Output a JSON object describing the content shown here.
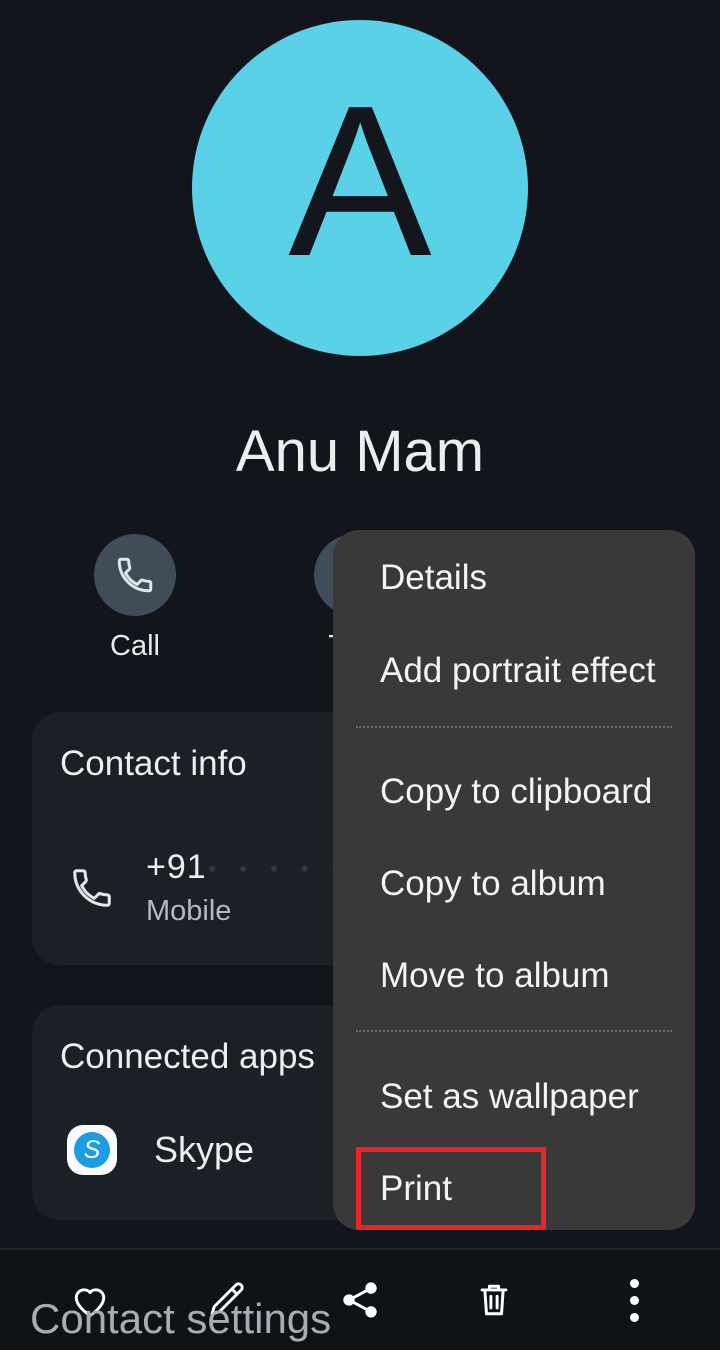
{
  "contact": {
    "avatar_letter": "A",
    "avatar_color": "#5bd1e8",
    "name": "Anu Mam"
  },
  "quick_actions": [
    {
      "id": "call",
      "label": "Call",
      "icon": "phone-icon"
    },
    {
      "id": "text",
      "label": "Text",
      "icon": "message-icon"
    }
  ],
  "cards": {
    "contact_info": {
      "title": "Contact info",
      "phone": {
        "icon": "phone-icon",
        "number_prefix": "+91",
        "number_redacted": "· · · · · · · · · ·",
        "type": "Mobile"
      }
    },
    "connected_apps": {
      "title": "Connected apps",
      "app": {
        "icon": "skype-icon",
        "icon_letter": "S",
        "label": "Skype"
      }
    }
  },
  "popup_menu": {
    "groups": [
      {
        "items": [
          "Details",
          "Add portrait effect"
        ]
      },
      {
        "items": [
          "Copy to clipboard",
          "Copy to album",
          "Move to album"
        ]
      },
      {
        "items": [
          "Set as wallpaper",
          "Print"
        ]
      }
    ],
    "items_flat": [
      "Details",
      "Add portrait effect",
      "Copy to clipboard",
      "Copy to album",
      "Move to album",
      "Set as wallpaper",
      "Print"
    ],
    "background_color": "#3b3937"
  },
  "highlights": {
    "color": "#e8252a",
    "targets": [
      "Print",
      "overflow-menu"
    ]
  },
  "bottom_bar": {
    "icons": [
      {
        "id": "favorite",
        "name": "heart-icon"
      },
      {
        "id": "edit",
        "name": "pencil-icon"
      },
      {
        "id": "share",
        "name": "share-icon"
      },
      {
        "id": "delete",
        "name": "trash-icon"
      },
      {
        "id": "overflow",
        "name": "overflow-menu-icon"
      }
    ]
  },
  "overlay_text": {
    "contact_settings": "Contact settings"
  }
}
